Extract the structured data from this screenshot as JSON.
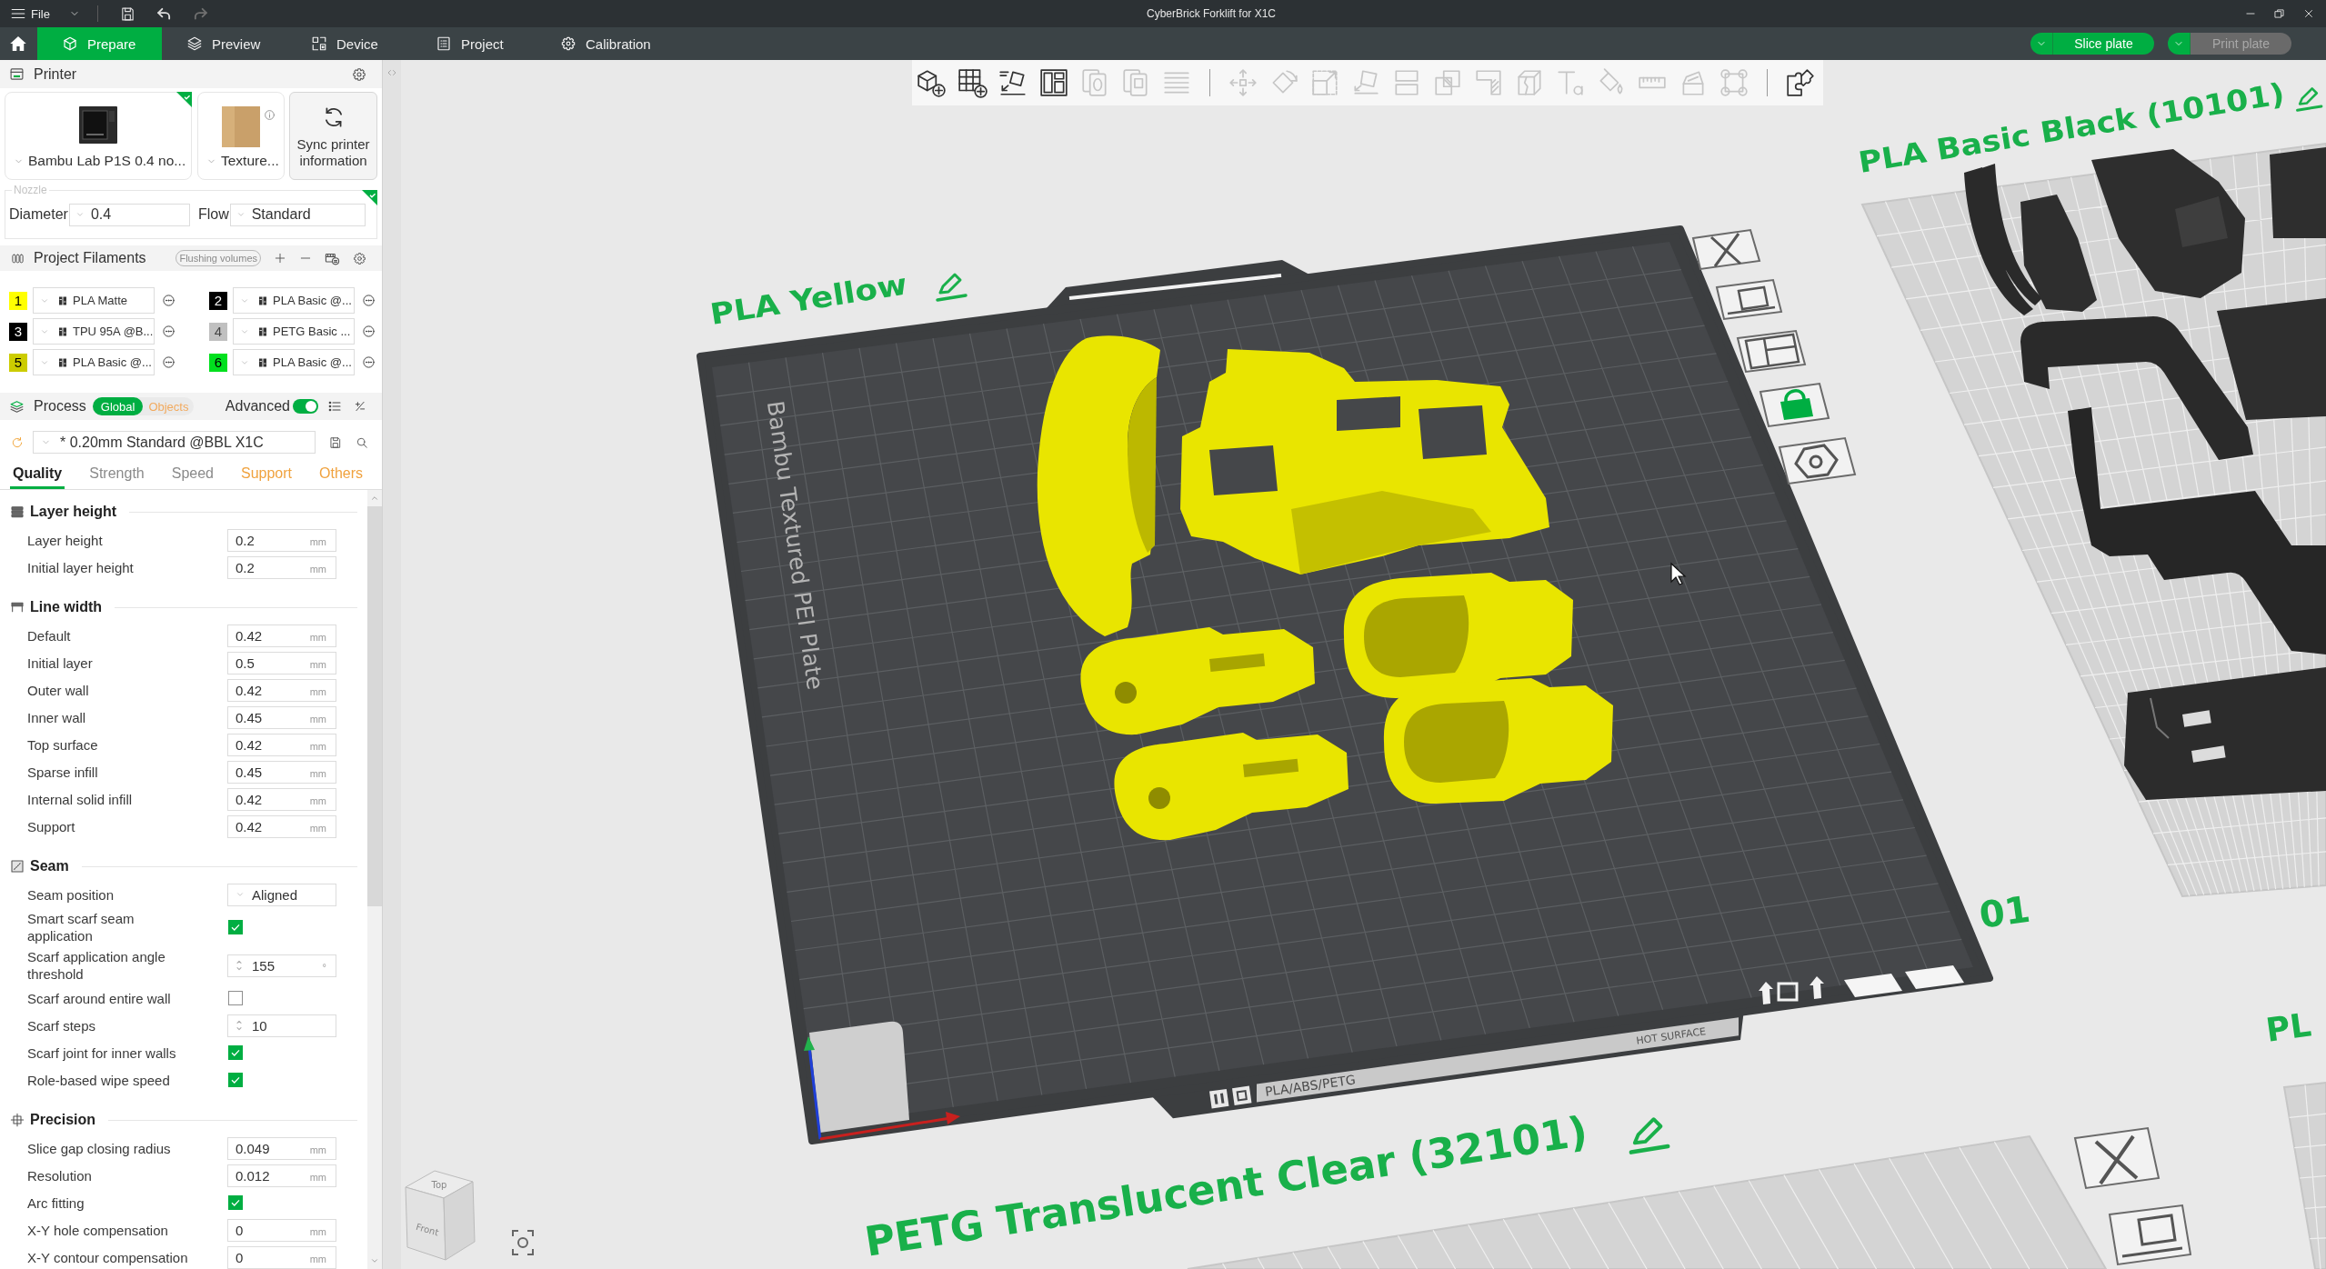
{
  "title_bar": {
    "menu": "File",
    "quick_actions": [
      {
        "kind": "save",
        "disabled": false
      },
      {
        "kind": "undo",
        "disabled": false
      },
      {
        "kind": "redo",
        "disabled": true
      }
    ],
    "title": "CyberBrick Forklift for X1C"
  },
  "nav": {
    "tabs": [
      {
        "kind": "prepare",
        "label": "Prepare",
        "selected": true
      },
      {
        "kind": "preview",
        "label": "Preview",
        "selected": false
      },
      {
        "kind": "device",
        "label": "Device",
        "selected": false
      },
      {
        "kind": "project",
        "label": "Project",
        "selected": false
      },
      {
        "kind": "calibration",
        "label": "Calibration",
        "selected": false
      }
    ],
    "actions": [
      {
        "label": "Slice plate",
        "disabled": false
      },
      {
        "label": "Print plate",
        "disabled": true
      }
    ]
  },
  "printer": {
    "title": "Printer",
    "model": {
      "name": "Bambu Lab P1S 0.4 no...",
      "synced": true
    },
    "plate": {
      "name": "Texture..."
    },
    "sync_button": "Sync printer information",
    "nozzle": {
      "legend": "Nozzle",
      "synced": true,
      "diameter_label": "Diameter",
      "diameter": "0.4",
      "flow_label": "Flow",
      "flow": "Standard"
    }
  },
  "filaments": {
    "title": "Project Filaments",
    "flushing_button": "Flushing volumes",
    "items": [
      {
        "number": "1",
        "color": "#ffff00",
        "name": "PLA Matte"
      },
      {
        "number": "2",
        "color": "#000000",
        "name": "PLA Basic @..."
      },
      {
        "number": "3",
        "color": "#000000",
        "name": "TPU 95A @B..."
      },
      {
        "number": "4",
        "color": "#c0c0c0",
        "name": "PETG Basic ..."
      },
      {
        "number": "5",
        "color": "#cccc00",
        "name": "PLA Basic @..."
      },
      {
        "number": "6",
        "color": "#00e01e",
        "name": "PLA Basic @..."
      }
    ]
  },
  "process": {
    "title": "Process",
    "scope": [
      {
        "label": "Global",
        "selected": true
      },
      {
        "label": "Objects",
        "selected": false
      }
    ],
    "advanced": {
      "label": "Advanced",
      "on": true
    },
    "preset": "* 0.20mm Standard @BBL X1C",
    "tabs": [
      {
        "label": "Quality",
        "selected": true,
        "modified": false
      },
      {
        "label": "Strength",
        "selected": false,
        "modified": false
      },
      {
        "label": "Speed",
        "selected": false,
        "modified": false
      },
      {
        "label": "Support",
        "selected": false,
        "modified": true
      },
      {
        "label": "Others",
        "selected": false,
        "modified": true
      }
    ]
  },
  "settings": {
    "sections": [
      {
        "title": "Layer height",
        "kind": "layers",
        "rows": [
          {
            "kind": "number",
            "label": "Layer height",
            "value": "0.2",
            "unit": "mm"
          },
          {
            "kind": "number",
            "label": "Initial layer height",
            "value": "0.2",
            "unit": "mm"
          }
        ]
      },
      {
        "title": "Line width",
        "kind": "width",
        "rows": [
          {
            "kind": "number",
            "label": "Default",
            "value": "0.42",
            "unit": "mm"
          },
          {
            "kind": "number",
            "label": "Initial layer",
            "value": "0.5",
            "unit": "mm"
          },
          {
            "kind": "number",
            "label": "Outer wall",
            "value": "0.42",
            "unit": "mm"
          },
          {
            "kind": "number",
            "label": "Inner wall",
            "value": "0.45",
            "unit": "mm"
          },
          {
            "kind": "number",
            "label": "Top surface",
            "value": "0.42",
            "unit": "mm"
          },
          {
            "kind": "number",
            "label": "Sparse infill",
            "value": "0.45",
            "unit": "mm"
          },
          {
            "kind": "number",
            "label": "Internal solid infill",
            "value": "0.42",
            "unit": "mm"
          },
          {
            "kind": "number",
            "label": "Support",
            "value": "0.42",
            "unit": "mm"
          }
        ]
      },
      {
        "title": "Seam",
        "kind": "seam",
        "rows": [
          {
            "kind": "select",
            "label": "Seam position",
            "value": "Aligned"
          },
          {
            "kind": "checkbox",
            "label": "Smart scarf seam application",
            "checked": true
          },
          {
            "kind": "spin",
            "label": "Scarf application angle threshold",
            "value": "155",
            "unit": "°"
          },
          {
            "kind": "checkbox",
            "label": "Scarf around entire wall",
            "checked": false
          },
          {
            "kind": "spin",
            "label": "Scarf steps",
            "value": "10"
          },
          {
            "kind": "checkbox",
            "label": "Scarf joint for inner walls",
            "checked": true
          },
          {
            "kind": "checkbox",
            "label": "Role-based wipe speed",
            "checked": true
          }
        ]
      },
      {
        "title": "Precision",
        "kind": "precision",
        "rows": [
          {
            "kind": "number",
            "label": "Slice gap closing radius",
            "value": "0.049",
            "unit": "mm"
          },
          {
            "kind": "number",
            "label": "Resolution",
            "value": "0.012",
            "unit": "mm"
          },
          {
            "kind": "checkbox",
            "label": "Arc fitting",
            "checked": true
          },
          {
            "kind": "number",
            "label": "X-Y hole compensation",
            "value": "0",
            "unit": "mm"
          },
          {
            "kind": "number",
            "label": "X-Y contour compensation",
            "value": "0",
            "unit": "mm"
          }
        ]
      }
    ]
  },
  "toolbar": {
    "groups": [
      {
        "items": [
          {
            "kind": "add-object",
            "disabled": false
          },
          {
            "kind": "add-plate",
            "disabled": false
          },
          {
            "kind": "auto-orient",
            "disabled": false
          },
          {
            "kind": "arrange",
            "disabled": false
          },
          {
            "kind": "split-objects",
            "disabled": true
          },
          {
            "kind": "split-parts",
            "disabled": true
          },
          {
            "kind": "layer-lines",
            "disabled": true
          }
        ]
      },
      {
        "items": [
          {
            "kind": "move",
            "disabled": true
          },
          {
            "kind": "rotate",
            "disabled": true
          },
          {
            "kind": "scale",
            "disabled": true
          },
          {
            "kind": "lay-on-face",
            "disabled": true
          },
          {
            "kind": "cut",
            "disabled": true
          },
          {
            "kind": "boolean",
            "disabled": true
          },
          {
            "kind": "support-paint",
            "disabled": true
          },
          {
            "kind": "seam-paint",
            "disabled": true
          },
          {
            "kind": "text",
            "disabled": true
          },
          {
            "kind": "color-paint",
            "disabled": true
          },
          {
            "kind": "measure",
            "disabled": true
          },
          {
            "kind": "assembly",
            "disabled": true
          },
          {
            "kind": "brim-ears",
            "disabled": true
          }
        ]
      },
      {
        "items": [
          {
            "kind": "assembly-view",
            "disabled": false
          }
        ]
      }
    ]
  },
  "viewport": {
    "plate_labels": [
      "PLA Yellow",
      "PLA Basic Black (10101)",
      "PETG Translucent Clear (32101)"
    ],
    "label_fragments": [
      "01",
      "PL"
    ],
    "bed": {
      "name": "Bambu Textured PEI Plate",
      "materials": "PLA/ABS/PETG",
      "warning": "HOT SURFACE"
    },
    "view_cube": {
      "top": "Top",
      "front": "Front"
    }
  }
}
